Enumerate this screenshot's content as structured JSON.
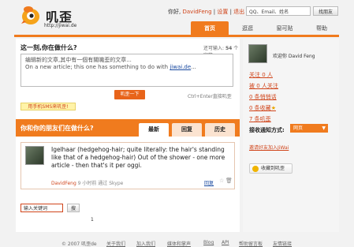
{
  "header": {
    "logo_text": "叽歪",
    "logo_url": "http://jiwai.de",
    "greeting": "你好,",
    "username": "DavidFeng",
    "settings_link": "设置",
    "logout_link": "退出",
    "separator": "|",
    "search_placeholder": "QQ、Email、姓名",
    "search_button": "找朋友"
  },
  "nav": {
    "tabs": [
      {
        "label": "首页",
        "active": true
      },
      {
        "label": "逛逛"
      },
      {
        "label": "窗可贴"
      },
      {
        "label": "帮助"
      }
    ]
  },
  "post": {
    "title": "这一刻,你在做什么?",
    "char_hint_prefix": "还可输入:",
    "char_count": "54",
    "char_hint_suffix": "个字符",
    "text_line1": "编辑新的文章,其中有一個有關嘰歪的文章...",
    "text_line2_prefix": "On a new article; this one has something to do with ",
    "text_line2_link": "jiwai.de",
    "text_line2_suffix": "...",
    "submit_label": "叽歪一下",
    "shortcut_hint": "Ctrl+Enter直接叽歪",
    "sms_link": "用手机SMS来叽歪!"
  },
  "friends": {
    "title": "你和你的朋友们在做什么?",
    "tabs": [
      "最新",
      "回复",
      "历史"
    ]
  },
  "status": {
    "text": "Igelhaar (hedgehog-hair; quite literally: the hair's standing like that of a hedgehog-hair) Out of the shower - one more article - then that's it per oggi.",
    "author": "DavidFeng",
    "meta": "9 小时前 通过 Skype",
    "reply_label": "回复",
    "star_icon": "star-icon",
    "trash_icon": "trash-icon"
  },
  "keyword_search": {
    "placeholder": "输入关键词",
    "button": "搜"
  },
  "pagination": {
    "current": "1"
  },
  "sidebar": {
    "welcome": "欢迎你 David Feng",
    "stats": [
      "关注 0 人",
      "被 0 人关注",
      "0 条悄悄话",
      "0 条收藏",
      "7 条叽歪"
    ],
    "notify_label": "接收通知方式:",
    "notify_value": "网页",
    "invite_link": "邀请好友加入JiWai",
    "bookmark_button": "收藏到叽歪"
  },
  "footer": {
    "copyright": "© 2007 叽歪de",
    "links": [
      "关于我们",
      "加入我们",
      "媒体和掌声",
      "Blog",
      "API",
      "帮助留言板",
      "友情链接"
    ]
  },
  "colors": {
    "accent": "#f07b1e",
    "link_red": "#d0451b"
  }
}
